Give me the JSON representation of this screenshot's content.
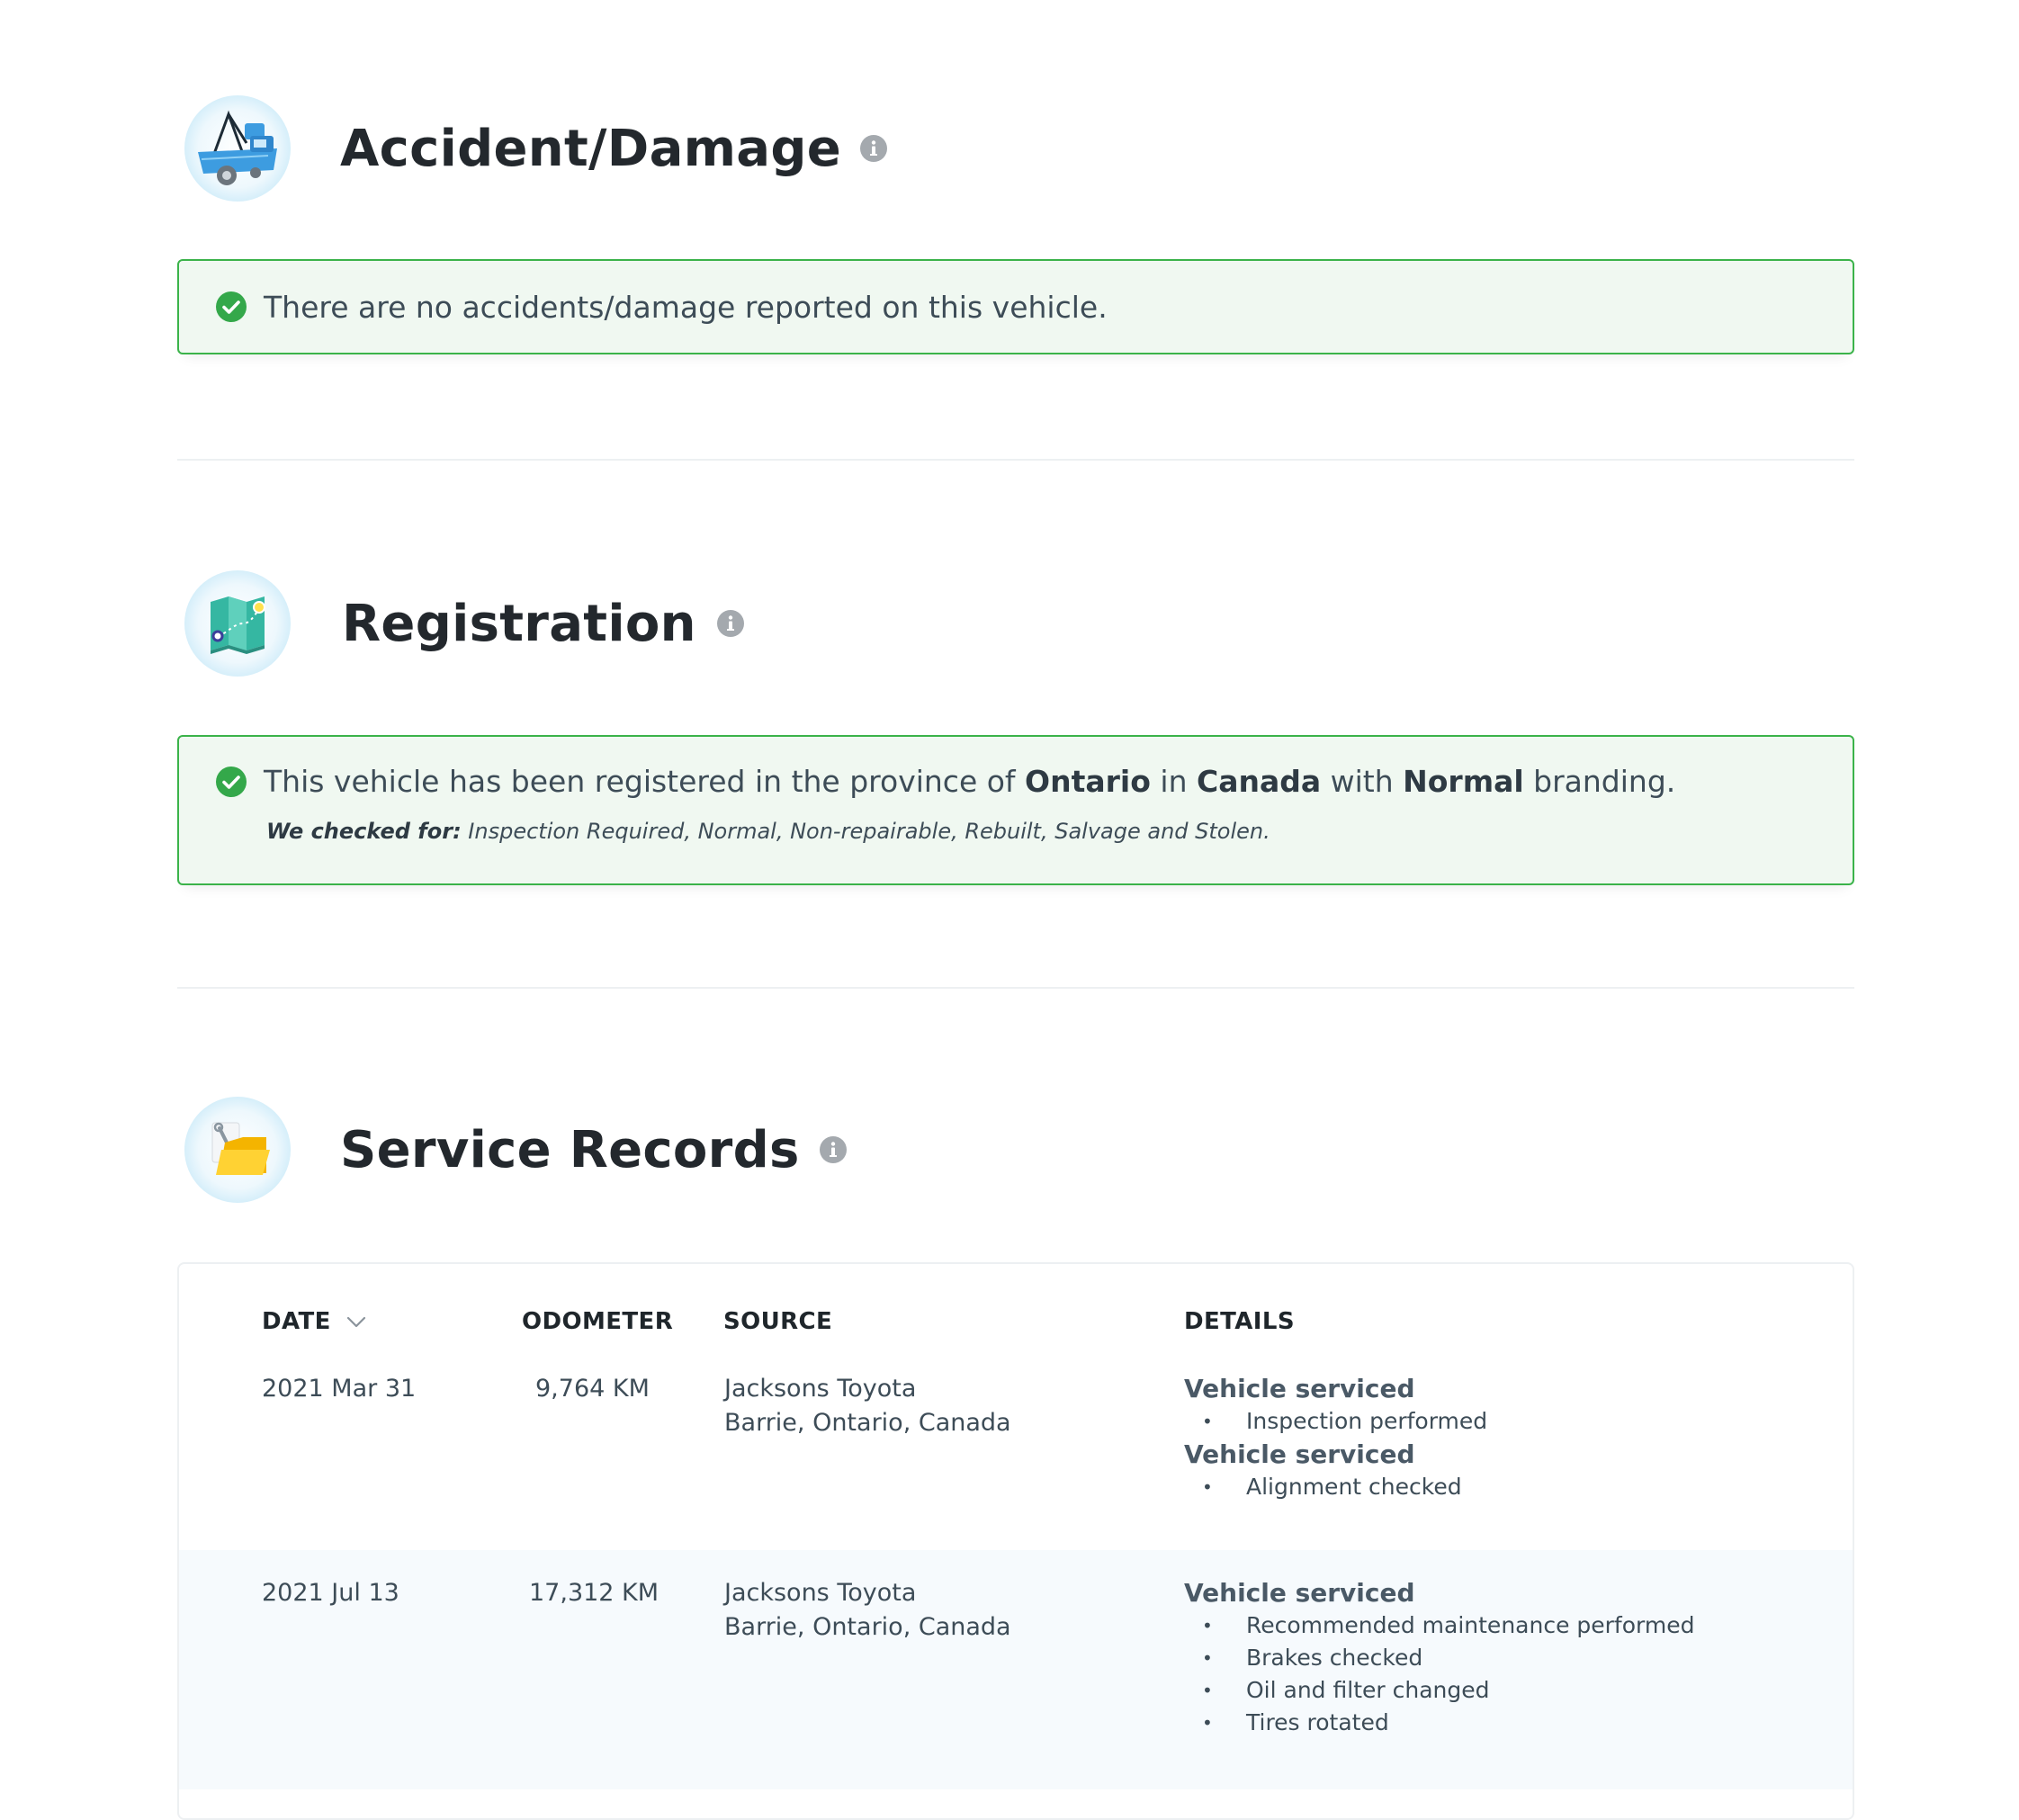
{
  "sections": {
    "accident": {
      "title": "Accident/Damage",
      "message": "There are no accidents/damage reported on this vehicle."
    },
    "registration": {
      "title": "Registration",
      "message_prefix": "This vehicle has been registered in the province of ",
      "province": "Ontario",
      "in_word": " in ",
      "country": "Canada",
      "with_word": " with ",
      "branding": "Normal",
      "message_suffix": " branding.",
      "checked_label": "We checked for:",
      "checked_items": " Inspection Required, Normal, Non-repairable, Rebuilt, Salvage and Stolen."
    },
    "service": {
      "title": "Service Records",
      "columns": [
        "DATE",
        "ODOMETER",
        "SOURCE",
        "DETAILS"
      ],
      "rows": [
        {
          "date": "2021 Mar 31",
          "odometer": "9,764 KM",
          "source_name": "Jacksons Toyota",
          "source_location": "Barrie, Ontario, Canada",
          "details": [
            {
              "title": "Vehicle serviced",
              "items": [
                "Inspection performed"
              ]
            },
            {
              "title": "Vehicle serviced",
              "items": [
                "Alignment checked"
              ]
            }
          ]
        },
        {
          "date": "2021 Jul 13",
          "odometer": "17,312 KM",
          "source_name": "Jacksons Toyota",
          "source_location": "Barrie, Ontario, Canada",
          "details": [
            {
              "title": "Vehicle serviced",
              "items": [
                "Recommended maintenance performed",
                "Brakes checked",
                "Oil and filter changed",
                "Tires rotated"
              ]
            }
          ]
        }
      ]
    }
  },
  "icons": {
    "accident": "tow-truck-icon",
    "registration": "map-icon",
    "service": "folder-wrench-icon",
    "info": "info-icon",
    "check": "check-circle-icon",
    "sort": "chevron-down-icon"
  },
  "colors": {
    "success_border": "#3bb34a",
    "success_bg": "#f0f8f1",
    "alt_row_bg": "#f6fafd",
    "heading": "#23282d"
  }
}
